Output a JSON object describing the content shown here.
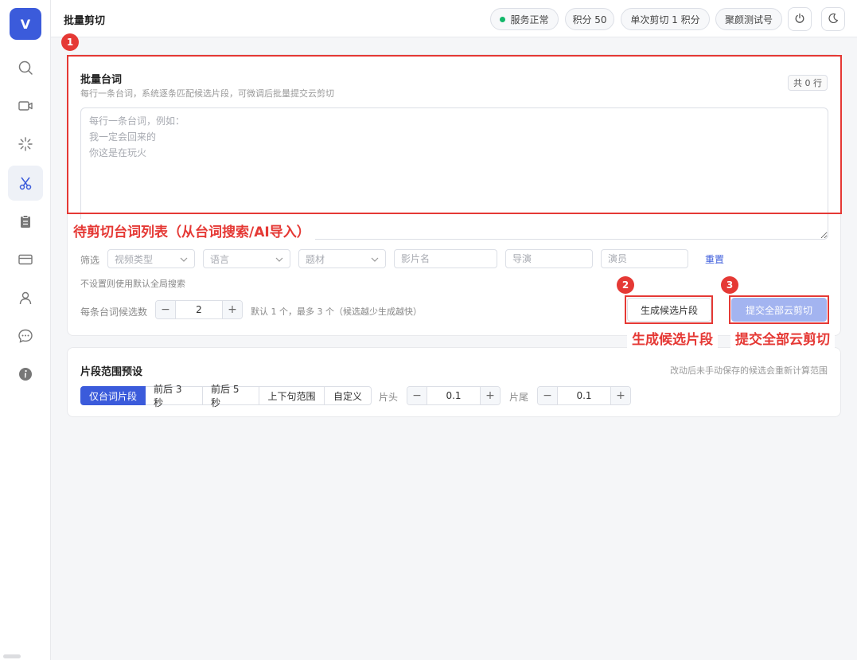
{
  "sidebar": {
    "logo": "V",
    "items": [
      {
        "icon": "search-icon"
      },
      {
        "icon": "video-icon"
      },
      {
        "icon": "loading-spark-icon"
      },
      {
        "icon": "scissors-icon",
        "active": true
      },
      {
        "icon": "clipboard-icon"
      },
      {
        "icon": "card-icon"
      },
      {
        "icon": "user-icon"
      },
      {
        "icon": "chat-icon"
      },
      {
        "icon": "info-icon"
      }
    ]
  },
  "header": {
    "title": "批量剪切",
    "status": "服务正常",
    "points": "积分 50",
    "cost": "单次剪切 1 积分",
    "account": "聚颜测试号"
  },
  "main_card": {
    "title": "批量台词",
    "subtitle": "每行一条台词，系统逐条匹配候选片段，可微调后批量提交云剪切",
    "count": "共 0 行",
    "textarea_placeholder": "每行一条台词，例如：\n我一定会回来的\n你这是在玩火",
    "filter_label": "筛选",
    "filters": {
      "video_type": "视频类型",
      "language": "语言",
      "subject": "题材",
      "movie_name": "影片名",
      "director": "导演",
      "actor": "演员"
    },
    "reset": "重置",
    "filter_note": "不设置则使用默认全局搜索",
    "candidates_label": "每条台词候选数",
    "candidates_value": "2",
    "candidates_note": "默认 1 个，最多 3 个（候选越少生成越快）",
    "generate_button": "生成候选片段",
    "submit_button": "提交全部云剪切"
  },
  "preset_card": {
    "title": "片段范围预设",
    "hint": "改动后未手动保存的候选会重新计算范围",
    "options": [
      "仅台词片段",
      "前后 3 秒",
      "前后 5 秒",
      "上下句范围",
      "自定义"
    ],
    "active_option": 0,
    "head_label": "片头",
    "head_value": "0.1",
    "tail_label": "片尾",
    "tail_value": "0.1"
  },
  "annotations": {
    "one": {
      "num": "1",
      "label": "待剪切台词列表（从台词搜索/AI导入）"
    },
    "two": {
      "num": "2",
      "label": "生成候选片段"
    },
    "three": {
      "num": "3",
      "label": "提交全部云剪切"
    }
  },
  "colors": {
    "primary": "#3b5bdb",
    "primary_disabled": "#a3b4f0",
    "annotation": "#e53935",
    "status_ok": "#12b76a"
  }
}
